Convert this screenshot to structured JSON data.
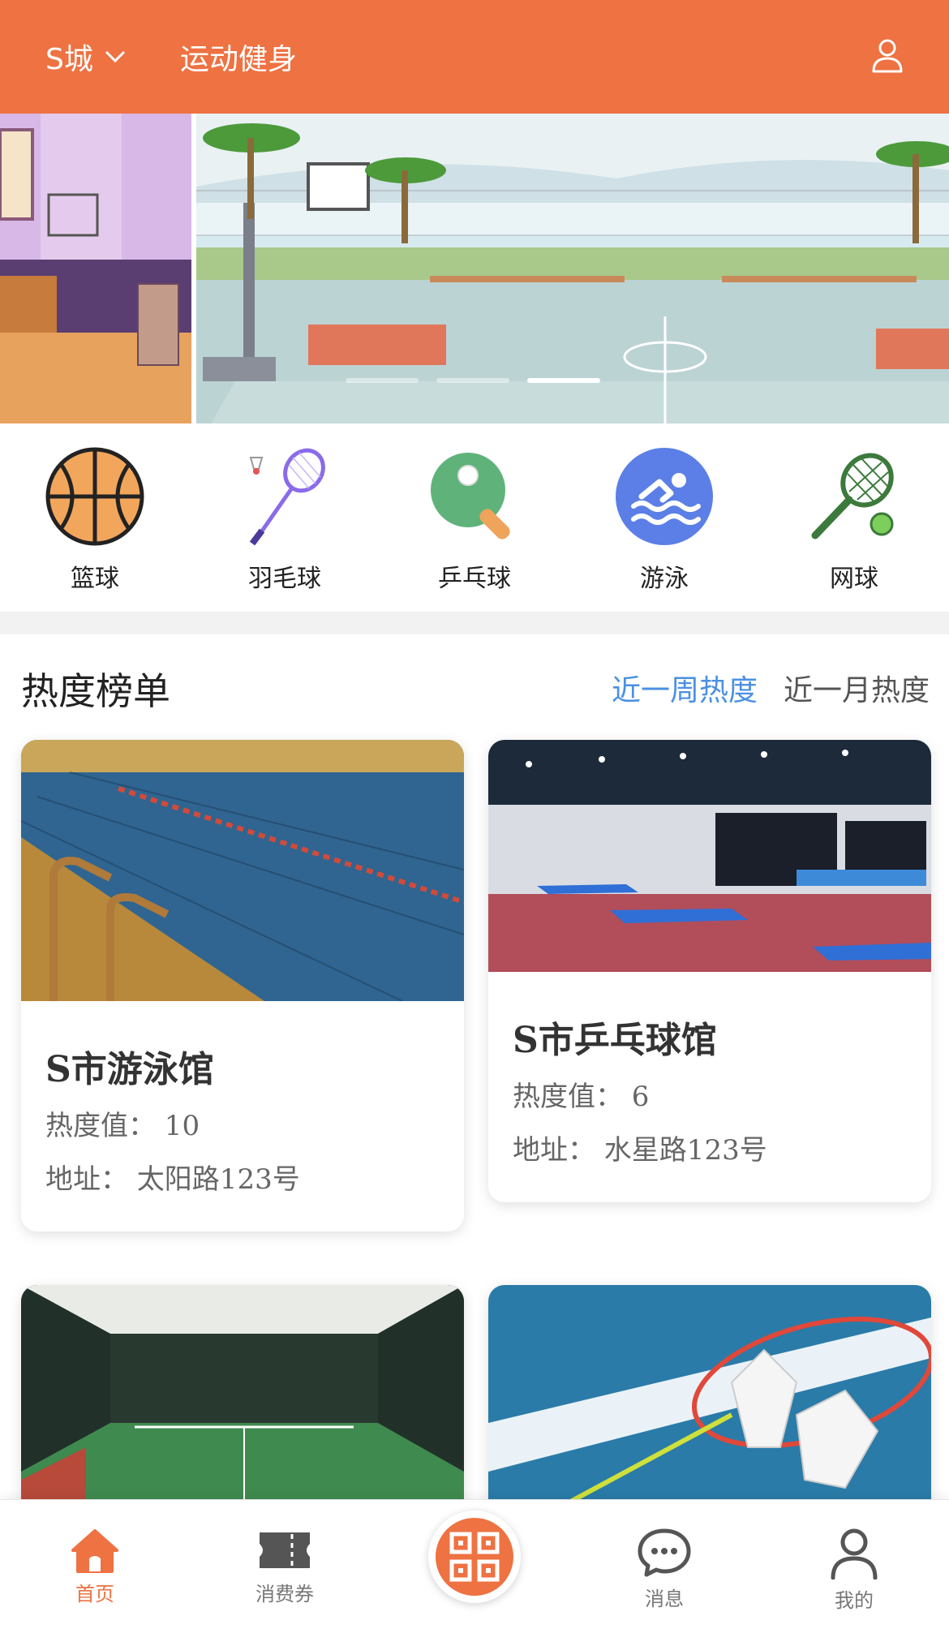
{
  "header": {
    "city": "S城",
    "title": "运动健身"
  },
  "banner": {
    "slide_count": 3,
    "active_slide": 3
  },
  "categories": [
    {
      "label": "篮球",
      "icon": "basketball-icon"
    },
    {
      "label": "羽毛球",
      "icon": "badminton-icon"
    },
    {
      "label": "乒乓球",
      "icon": "ping-pong-icon"
    },
    {
      "label": "游泳",
      "icon": "swimming-icon"
    },
    {
      "label": "网球",
      "icon": "tennis-icon"
    }
  ],
  "ranking": {
    "title": "热度榜单",
    "tabs": [
      {
        "label": "近一周热度",
        "active": true
      },
      {
        "label": "近一月热度",
        "active": false
      }
    ],
    "venues": [
      {
        "name": "S市游泳馆",
        "heat": "热度值：  10",
        "address": "地址：  太阳路123号"
      },
      {
        "name": "S市乒乓球馆",
        "heat": "热度值：  6",
        "address": "地址：  水星路123号"
      }
    ]
  },
  "bottom_nav": [
    {
      "label": "首页",
      "icon": "home-icon",
      "active": true
    },
    {
      "label": "消费券",
      "icon": "ticket-icon",
      "active": false
    },
    {
      "label": "",
      "icon": "qr-scan-icon",
      "active": false
    },
    {
      "label": "消息",
      "icon": "message-icon",
      "active": false
    },
    {
      "label": "我的",
      "icon": "profile-icon",
      "active": false
    }
  ],
  "colors": {
    "brand": "#ee7242",
    "active_tab": "#4a90e2",
    "swim_icon_bg": "#5b7fe6"
  }
}
